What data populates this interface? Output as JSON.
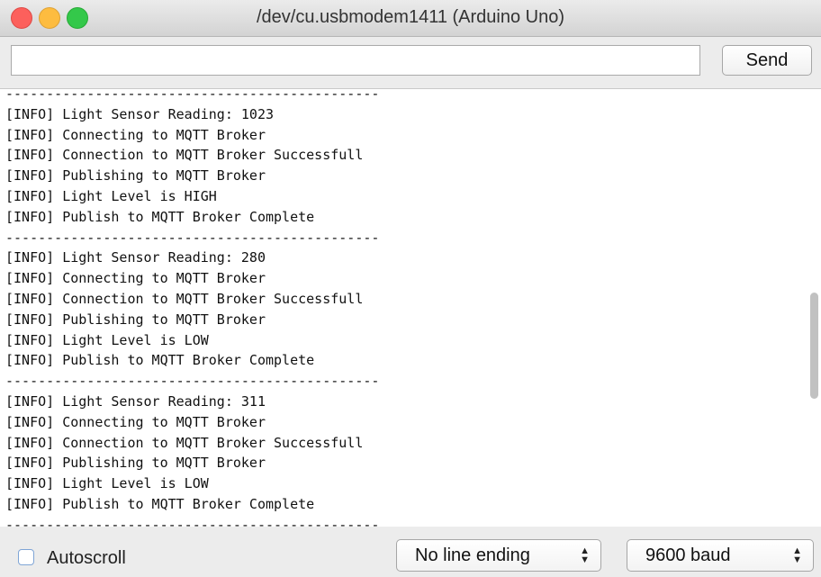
{
  "window": {
    "title": "/dev/cu.usbmodem1411 (Arduino Uno)"
  },
  "toolbar": {
    "input_value": "",
    "send_label": "Send"
  },
  "log": {
    "lines": [
      "----------------------------------------------",
      "[INFO] Light Sensor Reading: 1023",
      "[INFO] Connecting to MQTT Broker",
      "[INFO] Connection to MQTT Broker Successfull",
      "[INFO] Publishing to MQTT Broker",
      "[INFO] Light Level is HIGH",
      "[INFO] Publish to MQTT Broker Complete",
      "----------------------------------------------",
      "[INFO] Light Sensor Reading: 280",
      "[INFO] Connecting to MQTT Broker",
      "[INFO] Connection to MQTT Broker Successfull",
      "[INFO] Publishing to MQTT Broker",
      "[INFO] Light Level is LOW",
      "[INFO] Publish to MQTT Broker Complete",
      "----------------------------------------------",
      "[INFO] Light Sensor Reading: 311",
      "[INFO] Connecting to MQTT Broker",
      "[INFO] Connection to MQTT Broker Successfull",
      "[INFO] Publishing to MQTT Broker",
      "[INFO] Light Level is LOW",
      "[INFO] Publish to MQTT Broker Complete",
      "----------------------------------------------"
    ]
  },
  "footer": {
    "autoscroll_label": "Autoscroll",
    "autoscroll_checked": false,
    "line_ending_value": "No line ending",
    "baud_value": "9600 baud"
  },
  "icons": {
    "close": "close-traffic-light",
    "minimize": "minimize-traffic-light",
    "maximize": "maximize-traffic-light",
    "select_arrows": "updown-chevron-icon"
  },
  "colors": {
    "close": "#fc605c",
    "minimize": "#fdbc40",
    "maximize": "#34c84a",
    "log_background": "#ffffff"
  }
}
